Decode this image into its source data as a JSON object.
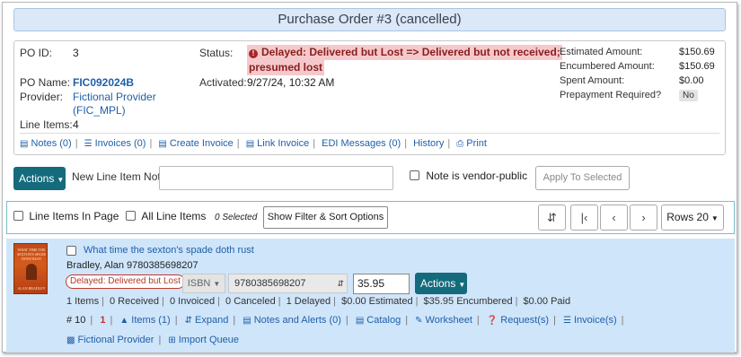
{
  "title": "Purchase Order #3 (cancelled)",
  "po": {
    "id_label": "PO ID:",
    "id_value": "3",
    "name_label": "PO Name:",
    "name_value": "FIC092024B",
    "provider_label": "Provider:",
    "provider_line1": "Fictional Provider",
    "provider_line2": "(FIC_MPL)",
    "line_items_label": "Line Items:",
    "line_items_value": "4",
    "status_label": "Status:",
    "status_line1": "Delayed: Delivered but Lost => Delivered but not received;",
    "status_line2": "presumed lost",
    "activated_label": "Activated:",
    "activated_value": "9/27/24, 10:32 AM",
    "estimated_label": "Estimated Amount:",
    "estimated_value": "$150.69",
    "encumbered_label": "Encumbered Amount:",
    "encumbered_value": "$150.69",
    "spent_label": "Spent Amount:",
    "spent_value": "$0.00",
    "prepay_label": "Prepayment Required?",
    "prepay_value": "No"
  },
  "po_links": {
    "notes": "Notes (0)",
    "invoices": "Invoices (0)",
    "create_invoice": "Create Invoice",
    "link_invoice": "Link Invoice",
    "edi": "EDI Messages (0)",
    "history": "History",
    "print": "Print"
  },
  "actions_row": {
    "actions_label": "Actions",
    "note_label": "New Line Item Note",
    "note_value": "",
    "vendor_public_label": "Note is vendor-public",
    "apply_label": "Apply To Selected"
  },
  "filter_row": {
    "line_items_in_page": "Line Items In Page",
    "all_line_items": "All Line Items",
    "selected": "0 Selected",
    "filter_button": "Show Filter & Sort Options",
    "rows_label": "Rows 20"
  },
  "line_item": {
    "cover": {
      "title": "WHAT TIME THE SEXTON'S SPADE DOTH RUST",
      "author": "ALAN BRADLEY"
    },
    "title": "What time the sexton's spade doth rust",
    "author_isbn": "Bradley, Alan 9780385698207",
    "status_pill": "Delayed: Delivered but Lost",
    "ident_type": "ISBN",
    "ident_value": "9780385698207",
    "price": "35.95",
    "actions_label": "Actions",
    "summary": [
      "1 Items",
      "0 Received",
      "0 Invoiced",
      "0 Canceled",
      "1 Delayed",
      "$0.00 Estimated",
      "$35.95 Encumbered",
      "$0.00 Paid"
    ],
    "line_number": "# 10",
    "red_count": "1",
    "links": {
      "items": "Items (1)",
      "expand": "Expand",
      "notes_alerts": "Notes and Alerts (0)",
      "catalog": "Catalog",
      "worksheet": "Worksheet",
      "requests": "Request(s)",
      "invoices": "Invoice(s)",
      "provider": "Fictional Provider",
      "import_queue": "Import Queue"
    }
  },
  "colors": {
    "teal": "#146b7c",
    "link": "#1f5fa8",
    "status_bg": "#f5c9cb",
    "panel": "#cfe5fa"
  }
}
